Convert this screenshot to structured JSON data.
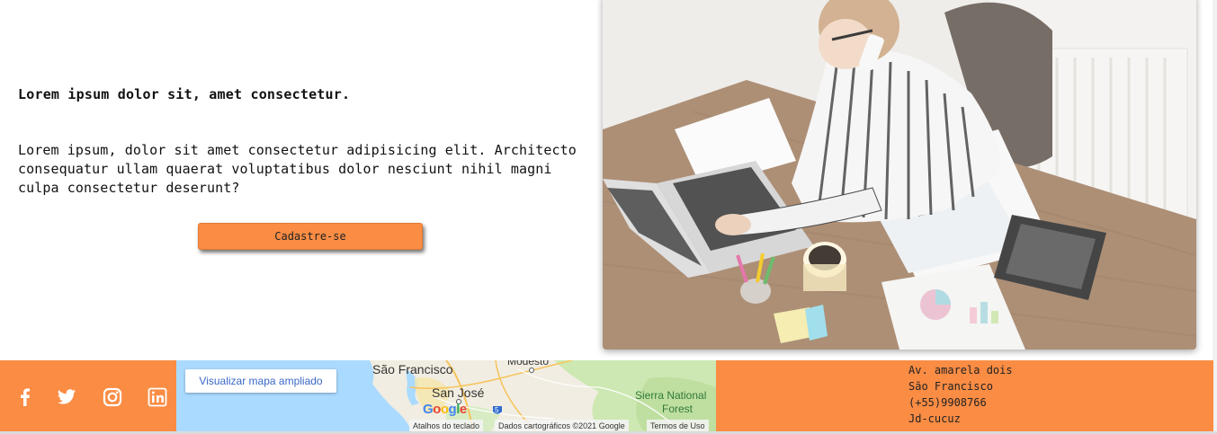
{
  "hero": {
    "heading": "Lorem ipsum dolor sit, amet consectetur.",
    "body": "Lorem ipsum, dolor sit amet consectetur adipisicing elit. Architecto consequatur ullam quaerat voluptatibus dolor nesciunt nihil magni culpa consectetur deserunt?",
    "cta_label": "Cadastre-se",
    "photo_icon": "woman-working-at-desk-photo"
  },
  "footer": {
    "social": [
      {
        "icon": "facebook-icon"
      },
      {
        "icon": "twitter-icon"
      },
      {
        "icon": "instagram-icon"
      },
      {
        "icon": "linkedin-icon"
      }
    ],
    "map": {
      "enlarge_label": "Visualizar mapa ampliado",
      "labels": {
        "san_francisco": "São Francisco",
        "san_jose": "San José",
        "modesto": "Modesto",
        "sierra_national_forest_1": "Sierra National",
        "sierra_national_forest_2": "Forest",
        "highway": "5"
      },
      "google_logo": "Google",
      "attribution": {
        "shortcuts": "Atalhos do teclado",
        "data": "Dados cartográficos ©2021 Google",
        "terms": "Termos de Uso"
      }
    },
    "address": {
      "line1": "Av. amarela dois",
      "line2": "São Francisco",
      "line3": "(+55)9908766",
      "line4": "Jd-cucuz"
    }
  },
  "colors": {
    "accent": "#fa8c44",
    "map_water": "#aadaff",
    "map_green": "#cde8b2"
  }
}
